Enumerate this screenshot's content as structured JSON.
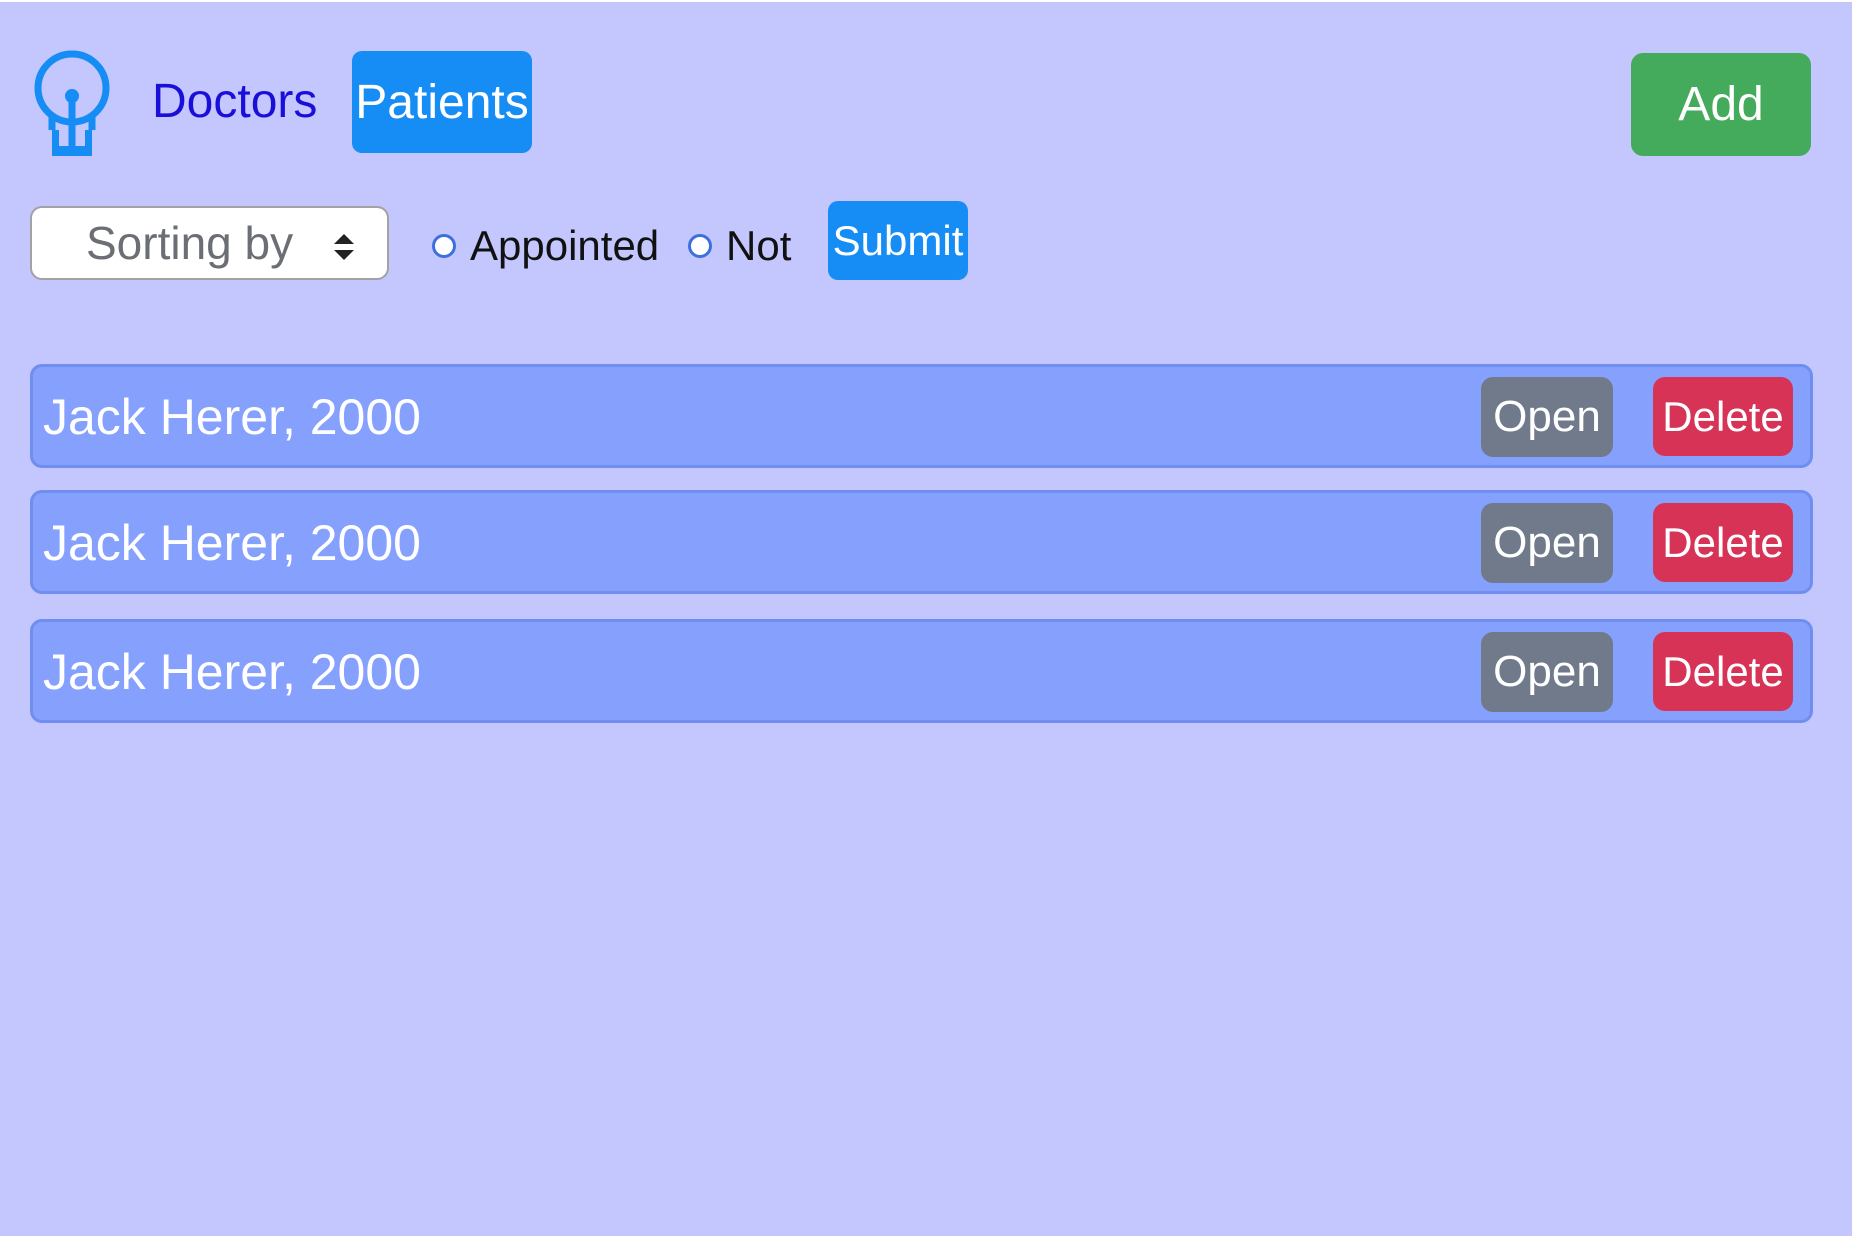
{
  "nav": {
    "logo_icon": "lightbulb-icon",
    "doctors_label": "Doctors",
    "patients_label": "Patients",
    "add_label": "Add"
  },
  "filters": {
    "sort_placeholder": "Sorting by",
    "radio_appointed": "Appointed",
    "radio_not": "Not",
    "submit_label": "Submit"
  },
  "patients": [
    {
      "name": "Jack Herer, 2000",
      "open_label": "Open",
      "delete_label": "Delete"
    },
    {
      "name": "Jack Herer, 2000",
      "open_label": "Open",
      "delete_label": "Delete"
    },
    {
      "name": "Jack Herer, 2000",
      "open_label": "Open",
      "delete_label": "Delete"
    }
  ],
  "colors": {
    "background": "#c4c6fe",
    "primary": "#168cf5",
    "success": "#44aa5c",
    "secondary": "#707a8a",
    "danger": "#d63356",
    "row": "#86a0fd",
    "link": "#1a0fd9"
  }
}
